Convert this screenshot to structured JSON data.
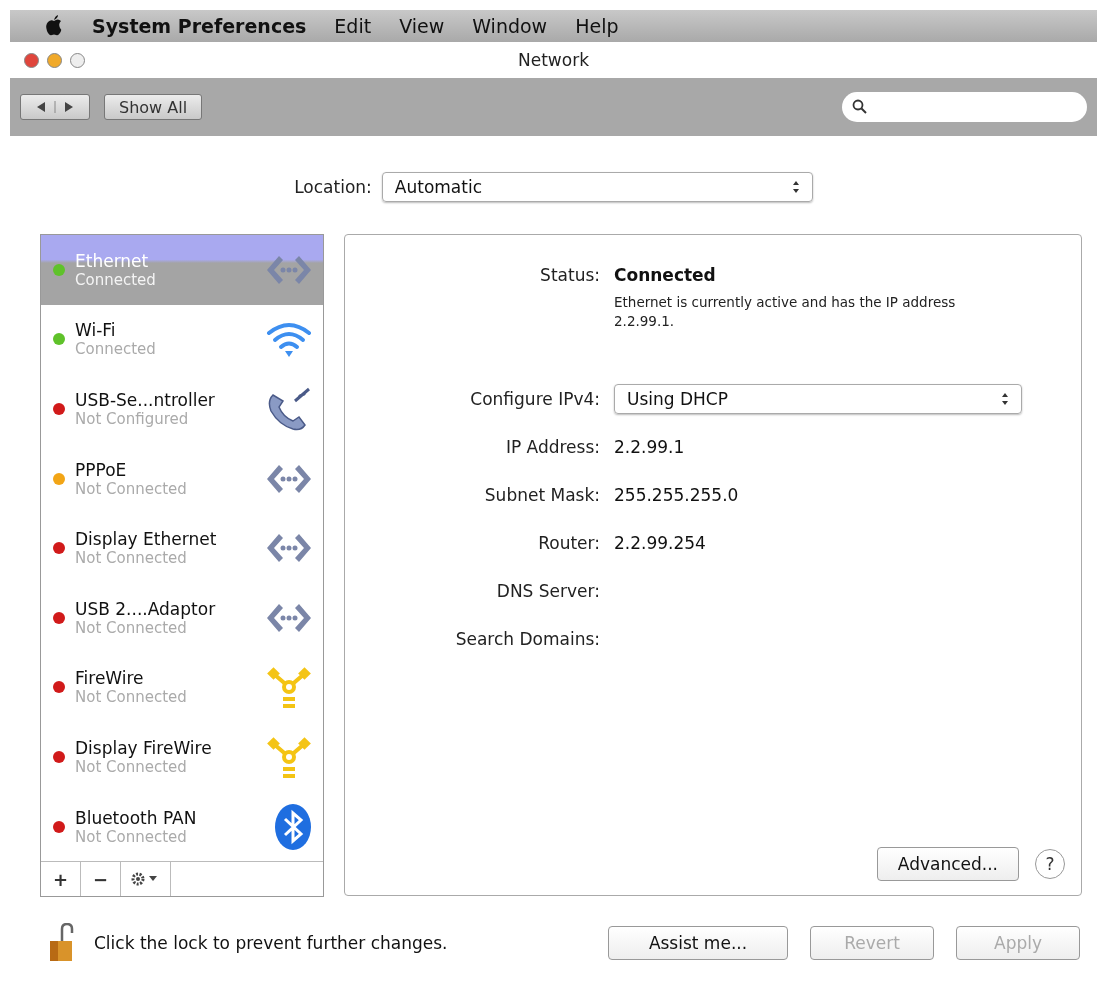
{
  "menu_bar": {
    "app_name": "System Preferences",
    "items": [
      "Edit",
      "View",
      "Window",
      "Help"
    ]
  },
  "window": {
    "title": "Network"
  },
  "toolbar": {
    "show_all": "Show All"
  },
  "location": {
    "label": "Location:",
    "value": "Automatic"
  },
  "services": [
    {
      "name": "Ethernet",
      "status": "Connected",
      "color": "#5fc22a",
      "kind": "ethernet",
      "selected": true
    },
    {
      "name": "Wi-Fi",
      "status": "Connected",
      "color": "#5fc22a",
      "kind": "wifi",
      "selected": false
    },
    {
      "name": "USB-Se...ntroller",
      "status": "Not Configured",
      "color": "#d11a1a",
      "kind": "phone",
      "selected": false
    },
    {
      "name": "PPPoE",
      "status": "Not Connected",
      "color": "#f2a516",
      "kind": "ethernet",
      "selected": false
    },
    {
      "name": "Display Ethernet",
      "status": "Not Connected",
      "color": "#d11a1a",
      "kind": "ethernet",
      "selected": false
    },
    {
      "name": "USB 2....Adaptor",
      "status": "Not Connected",
      "color": "#d11a1a",
      "kind": "ethernet",
      "selected": false
    },
    {
      "name": "FireWire",
      "status": "Not Connected",
      "color": "#d11a1a",
      "kind": "firewire",
      "selected": false
    },
    {
      "name": "Display FireWire",
      "status": "Not Connected",
      "color": "#d11a1a",
      "kind": "firewire",
      "selected": false
    },
    {
      "name": "Bluetooth PAN",
      "status": "Not Connected",
      "color": "#d11a1a",
      "kind": "bluetooth",
      "selected": false
    }
  ],
  "list_footer": {
    "add": "+",
    "remove": "−"
  },
  "detail": {
    "status_label": "Status:",
    "status_value": "Connected",
    "status_text": "Ethernet is currently active and has the IP address 2.2.99.1.",
    "fields": [
      {
        "label": "Configure IPv4:",
        "value": "Using DHCP",
        "kind": "select"
      },
      {
        "label": "IP Address:",
        "value": "2.2.99.1",
        "kind": "text"
      },
      {
        "label": "Subnet Mask:",
        "value": "255.255.255.0",
        "kind": "text"
      },
      {
        "label": "Router:",
        "value": "2.2.99.254",
        "kind": "text"
      },
      {
        "label": "DNS Server:",
        "kind": "text"
      },
      {
        "label": "Search Domains:",
        "kind": "text"
      }
    ],
    "advanced": "Advanced...",
    "help": "?"
  },
  "lock_text": "Click the lock to prevent further changes.",
  "buttons": [
    {
      "label": "Assist me...",
      "disabled": false
    },
    {
      "label": "Revert",
      "disabled": true
    },
    {
      "label": "Apply",
      "disabled": true
    }
  ]
}
